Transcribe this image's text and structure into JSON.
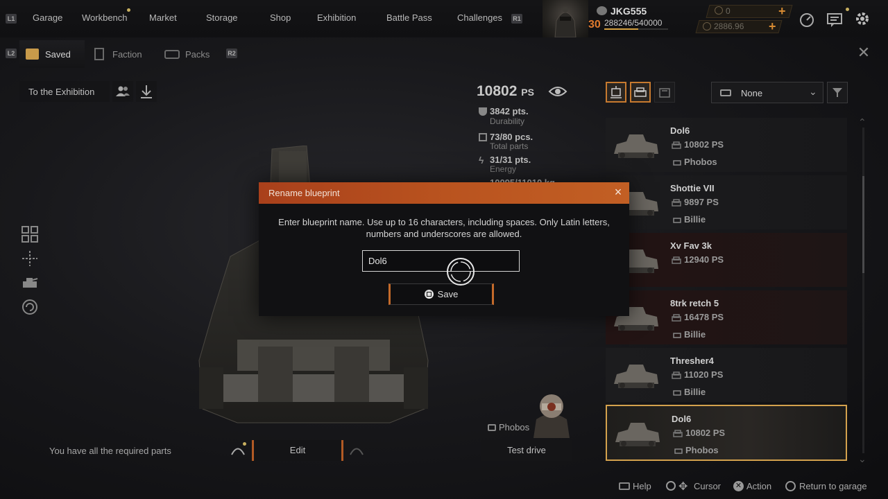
{
  "topnav": {
    "left_hint": "L1",
    "right_hint": "R1",
    "items": [
      "Garage",
      "Workbench",
      "Market",
      "Storage",
      "Shop",
      "Exhibition",
      "Battle Pass",
      "Challenges"
    ]
  },
  "player": {
    "username": "JKG555",
    "level": "30",
    "xp": "288246/540000",
    "xp_fraction": 0.534,
    "coins": "0",
    "credits": "2886.96"
  },
  "tabs": {
    "left_hint": "L2",
    "right_hint": "R2",
    "items": [
      "Saved",
      "Faction",
      "Packs"
    ]
  },
  "left_panel": {
    "exhibition_label": "To the Exhibition"
  },
  "stats": {
    "ps_value": "10802",
    "ps_unit": "PS",
    "durability_value": "3842 pts.",
    "durability_label": "Durability",
    "parts_value": "73/80 pcs.",
    "parts_label": "Total parts",
    "energy_value": "31/31 pts.",
    "energy_label": "Energy",
    "mass_value_partial": "10095/11010 kg"
  },
  "filter": {
    "dropdown_value": "None"
  },
  "blueprints": [
    {
      "name": "Dol6",
      "ps": "10802 PS",
      "faction": "Phobos",
      "style": "normal"
    },
    {
      "name": "Shottie VII",
      "ps": "9897 PS",
      "faction": "Billie",
      "style": "normal"
    },
    {
      "name": "Xv Fav 3k",
      "ps": "12940 PS",
      "faction": "",
      "style": "reddish"
    },
    {
      "name": "8trk retch 5",
      "ps": "16478 PS",
      "faction": "Billie",
      "style": "reddish"
    },
    {
      "name": "Thresher4",
      "ps": "11020 PS",
      "faction": "Billie",
      "style": "normal"
    },
    {
      "name": "Dol6",
      "ps": "10802 PS",
      "faction": "Phobos",
      "style": "selected"
    }
  ],
  "bottom": {
    "required_parts": "You have all the required parts",
    "edit_label": "Edit",
    "driver_faction": "Phobos",
    "test_drive_label": "Test drive"
  },
  "footer_hints": {
    "help": "Help",
    "cursor": "Cursor",
    "action": "Action",
    "return": "Return to garage"
  },
  "modal": {
    "title": "Rename blueprint",
    "message": "Enter blueprint name. Use up to 16 characters, including spaces. Only Latin letters, numbers and underscores are allowed.",
    "input_value": "Dol6",
    "save_label": "Save"
  },
  "colors": {
    "accent_orange": "#c46a2a",
    "modal_header": "#b9531f",
    "selected_border": "#d4a24d",
    "level_orange": "#e07a2e"
  }
}
